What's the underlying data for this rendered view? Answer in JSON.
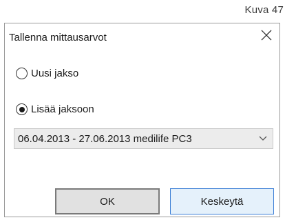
{
  "figure_label": "Kuva 47",
  "dialog": {
    "title": "Tallenna mittausarvot",
    "close_icon": "close-icon"
  },
  "options": {
    "new_period": {
      "label": "Uusi jakso",
      "selected": false
    },
    "add_to_period": {
      "label": "Lisää jaksoon",
      "selected": true
    }
  },
  "period_select": {
    "value": "06.04.2013 - 27.06.2013 medilife PC3",
    "arrow_icon": "chevron-down-icon"
  },
  "buttons": {
    "ok": "OK",
    "cancel": "Keskeytä"
  },
  "colors": {
    "cancel_border": "#3c7fd6",
    "cancel_bg": "#e5f1fb",
    "ok_bg": "#e1e1e1"
  }
}
